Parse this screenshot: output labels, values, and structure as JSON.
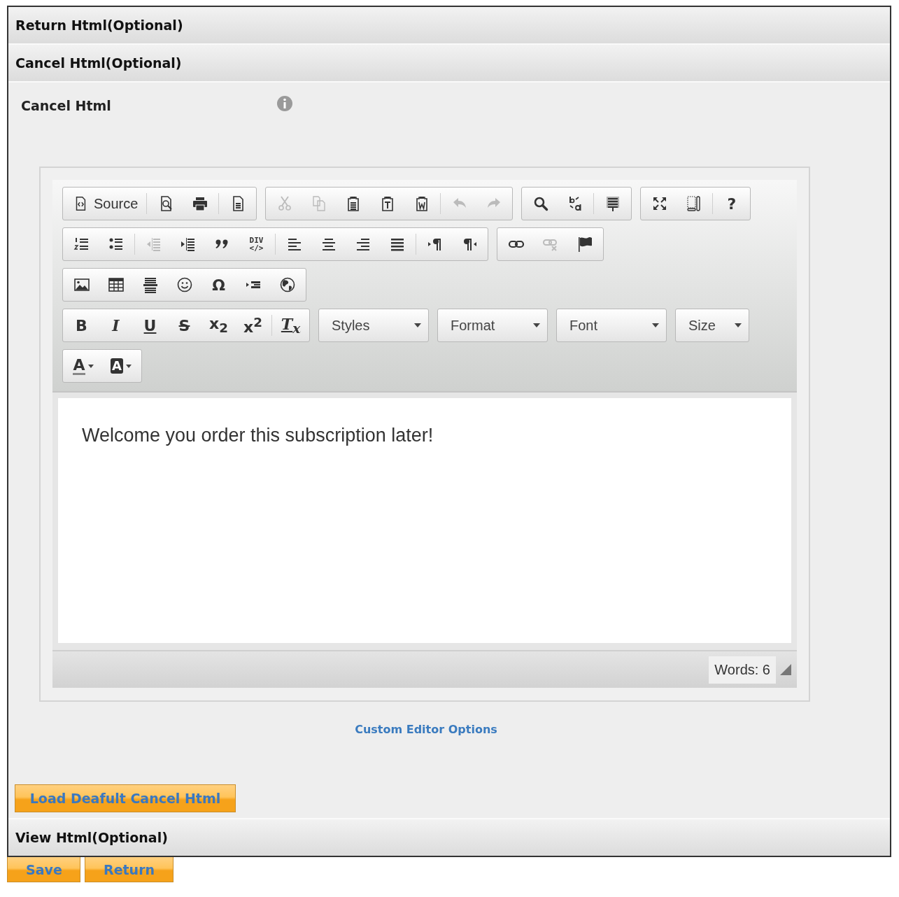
{
  "top_sections": [
    {
      "title": "Return Html(Optional)"
    },
    {
      "title": "Cancel Html(Optional)"
    }
  ],
  "field": {
    "label": "Cancel Html"
  },
  "editor": {
    "toolbar": [
      [
        [
          {
            "kind": "label",
            "label": "Source",
            "disabled": false
          },
          {
            "kind": "separator"
          },
          {
            "kind": "icon",
            "disabled": false
          },
          {
            "kind": "icon",
            "disabled": false
          },
          {
            "kind": "separator"
          },
          {
            "kind": "icon",
            "disabled": false
          }
        ],
        [
          {
            "kind": "icon",
            "disabled": true
          },
          {
            "kind": "icon",
            "disabled": true
          },
          {
            "kind": "icon",
            "disabled": false
          },
          {
            "kind": "icon",
            "disabled": false
          },
          {
            "kind": "icon",
            "disabled": false
          },
          {
            "kind": "separator"
          },
          {
            "kind": "icon",
            "disabled": true
          },
          {
            "kind": "icon",
            "disabled": true
          }
        ],
        [
          {
            "kind": "icon",
            "disabled": false
          },
          {
            "kind": "icon",
            "disabled": false
          },
          {
            "kind": "separator"
          },
          {
            "kind": "icon",
            "disabled": false
          }
        ],
        [
          {
            "kind": "icon",
            "disabled": false
          },
          {
            "kind": "icon",
            "disabled": false
          },
          {
            "kind": "separator"
          },
          {
            "kind": "glyph",
            "label": "?",
            "disabled": false
          }
        ]
      ],
      [
        [
          {
            "kind": "icon",
            "disabled": false
          },
          {
            "kind": "icon",
            "disabled": false
          },
          {
            "kind": "separator"
          },
          {
            "kind": "icon",
            "disabled": true
          },
          {
            "kind": "icon",
            "disabled": false
          },
          {
            "kind": "icon",
            "disabled": false
          },
          {
            "kind": "glyph",
            "label": "DIV",
            "sublabel": "</>",
            "disabled": false
          },
          {
            "kind": "separator"
          },
          {
            "kind": "icon",
            "disabled": false
          },
          {
            "kind": "icon",
            "disabled": false
          },
          {
            "kind": "icon",
            "disabled": false
          },
          {
            "kind": "icon",
            "disabled": false
          },
          {
            "kind": "separator"
          },
          {
            "kind": "icon",
            "disabled": false
          },
          {
            "kind": "icon",
            "disabled": false
          }
        ],
        [
          {
            "kind": "icon",
            "disabled": false
          },
          {
            "kind": "icon",
            "disabled": true
          },
          {
            "kind": "icon",
            "disabled": false
          }
        ]
      ],
      [
        [
          {
            "kind": "icon",
            "disabled": false
          },
          {
            "kind": "icon",
            "disabled": false
          },
          {
            "kind": "icon",
            "disabled": false
          },
          {
            "kind": "icon",
            "disabled": false
          },
          {
            "kind": "glyph",
            "label": "Ω",
            "disabled": false
          },
          {
            "kind": "icon",
            "disabled": false
          },
          {
            "kind": "icon",
            "disabled": false
          }
        ]
      ],
      [
        [
          {
            "kind": "glyph",
            "label": "B",
            "disabled": false
          },
          {
            "kind": "glyph",
            "label": "I",
            "disabled": false
          },
          {
            "kind": "glyph",
            "label": "U",
            "disabled": false
          },
          {
            "kind": "glyph",
            "label": "S",
            "disabled": false
          },
          {
            "kind": "glyph",
            "label": "x$_{2}$",
            "disabled": false
          },
          {
            "kind": "glyph",
            "label": "x$^{2}$",
            "disabled": false
          },
          {
            "kind": "separator"
          },
          {
            "kind": "glyph",
            "label": "T$_{x}$",
            "disabled": false
          }
        ],
        [
          {
            "kind": "combo",
            "label": "Styles"
          }
        ],
        [
          {
            "kind": "combo",
            "label": "Format"
          }
        ],
        [
          {
            "kind": "combo",
            "label": "Font"
          }
        ],
        [
          {
            "kind": "combo",
            "label": "Size"
          }
        ]
      ],
      [
        [
          {
            "kind": "color",
            "label": "A"
          },
          {
            "kind": "bgcolor",
            "label": "A"
          }
        ]
      ]
    ],
    "content": "Welcome you order this subscription later!",
    "word_count": "Words: 6"
  },
  "options_link": "Custom Editor Options",
  "load_button": "Load Deafult Cancel Html",
  "bottom_section": {
    "title": "View Html(Optional)"
  },
  "buttons": [
    "Save",
    "Return"
  ]
}
